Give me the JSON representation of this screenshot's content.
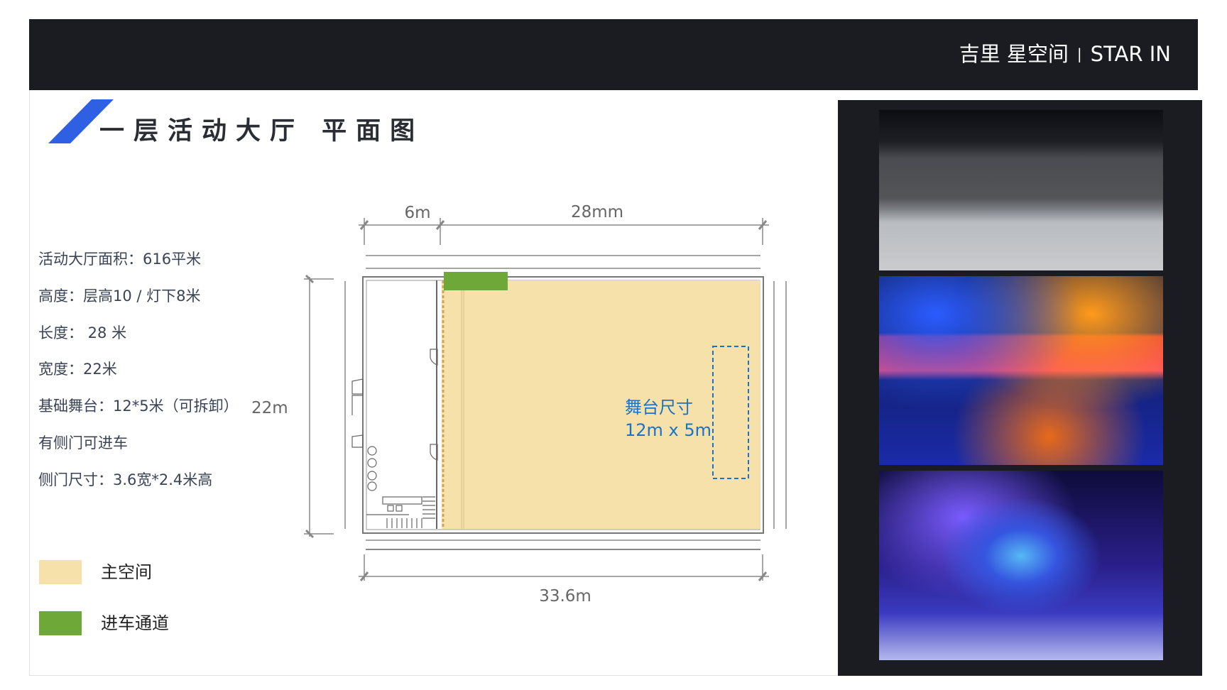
{
  "header": {
    "brand_cn": "吉里 星空间",
    "separator": "|",
    "brand_en": "STAR IN"
  },
  "title": "一层活动大厅  平面图",
  "info": [
    "活动大厅面积：616平米",
    "高度：层高10 / 灯下8米",
    "长度： 28 米",
    "宽度：22米",
    "基础舞台：12*5米（可拆卸）",
    "有侧门可进车",
    "侧门尺寸：3.6宽*2.4米高"
  ],
  "floorplan": {
    "dim_top_left": "6m",
    "dim_top_right": "28mm",
    "dim_left": "22m",
    "dim_bottom": "33.6m",
    "stage_title": "舞台尺寸",
    "stage_size": "12m x 5m"
  },
  "legend": [
    {
      "label": "主空间",
      "color": "#f5e1a9"
    },
    {
      "label": "进车通道",
      "color": "#6ea839"
    }
  ],
  "colors": {
    "header_bg": "#1b1c21",
    "accent_blue": "#2f5fe3",
    "stage_blue": "#1a73c8"
  },
  "photos": [
    "empty-hall-stage-photo",
    "event-stage-lighting-photo",
    "gala-stage-audience-photo"
  ]
}
